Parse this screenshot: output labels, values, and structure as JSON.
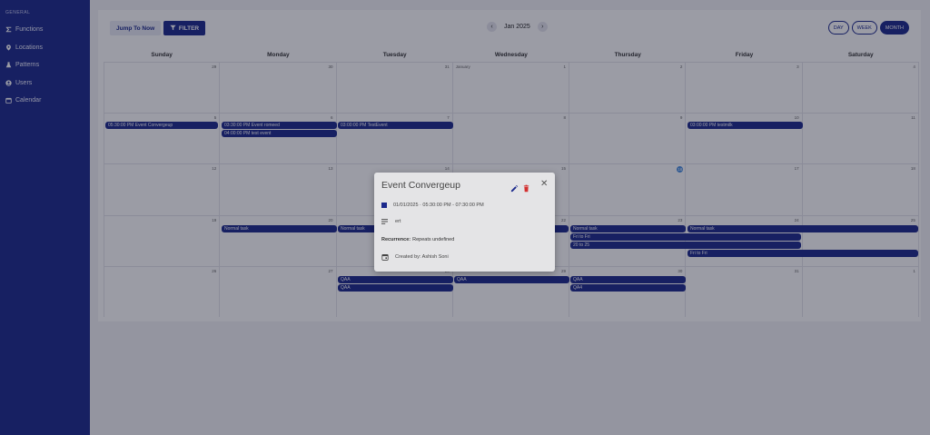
{
  "sidebar": {
    "section_title": "GENERAL",
    "items": [
      {
        "label": "Functions",
        "icon": "sigma-icon"
      },
      {
        "label": "Locations",
        "icon": "location-pin-icon"
      },
      {
        "label": "Patterns",
        "icon": "flask-icon"
      },
      {
        "label": "Users",
        "icon": "user-circle-icon"
      },
      {
        "label": "Calendar",
        "icon": "calendar-icon"
      }
    ]
  },
  "toolbar": {
    "jump_label": "Jump To Now",
    "filter_label": "FILTER",
    "month_label": "Jan 2025",
    "prev": "‹",
    "next": "›",
    "views": [
      "DAY",
      "WEEK",
      "MONTH"
    ],
    "active_view": "MONTH"
  },
  "calendar": {
    "days_of_week": [
      "Sunday",
      "Monday",
      "Tuesday",
      "Wednesday",
      "Thursday",
      "Friday",
      "Saturday"
    ],
    "month_label": "January",
    "weeks": [
      [
        "29",
        "30",
        "31",
        "1",
        "2",
        "3",
        "4"
      ],
      [
        "5",
        "6",
        "7",
        "8",
        "9",
        "10",
        "11"
      ],
      [
        "12",
        "13",
        "14",
        "15",
        "16",
        "17",
        "18"
      ],
      [
        "19",
        "20",
        "21",
        "22",
        "23",
        "24",
        "25"
      ],
      [
        "26",
        "27",
        "28",
        "29",
        "30",
        "31",
        "1"
      ]
    ],
    "today": "15",
    "events": {
      "w1_sun": "05:30:00 PM Event Convergeup",
      "w1_mon_1": "03:30:00 PM Event romeed",
      "w1_mon_2": "04:00:00 PM test event",
      "w1_tue": "03:00:00 PM TestEvent",
      "w1_fri": "03:00:00 PM testmilk",
      "w3_mon": "Normal task",
      "w3_tue": "Normal task",
      "w3_thu_1": "Normal task",
      "w3_thu_2": "Fri to Fri",
      "w3_thu_3": "20 to 25",
      "w3_fri": "Normal task",
      "w3_fri_2": "Fri to Fri",
      "w4_tue_1": "QAA",
      "w4_tue_2": "QAA",
      "w4_wed": "QAA",
      "w4_thu_1": "QAA",
      "w4_thu_2": "QA4"
    }
  },
  "popup": {
    "title": "Event Convergeup",
    "datetime": "01/01/2025 · 05:30:00 PM - 07:30:00 PM",
    "description": "ert",
    "recurrence_label": "Recurrence:",
    "recurrence_value": "Repeats undefined",
    "created_by": "Created by: Ashish Soni",
    "close": "✕"
  },
  "colors": {
    "brand": "#1c2a8c",
    "delete": "#d32f2f",
    "today": "#4b8fe0"
  }
}
